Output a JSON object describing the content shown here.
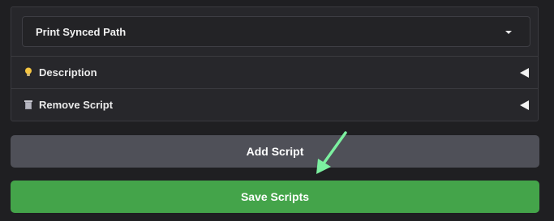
{
  "script_select": {
    "value": "Print Synced Path"
  },
  "sections": [
    {
      "label": "Description",
      "icon": "lightbulb-icon"
    },
    {
      "label": "Remove Script",
      "icon": "trash-icon"
    }
  ],
  "buttons": {
    "add_label": "Add Script",
    "save_label": "Save Scripts"
  },
  "colors": {
    "save_button": "#44a44a",
    "add_button": "#4f5058",
    "annotation_arrow": "#7cf0a0"
  },
  "annotation": {
    "icon": "arrow-pointer-icon"
  }
}
